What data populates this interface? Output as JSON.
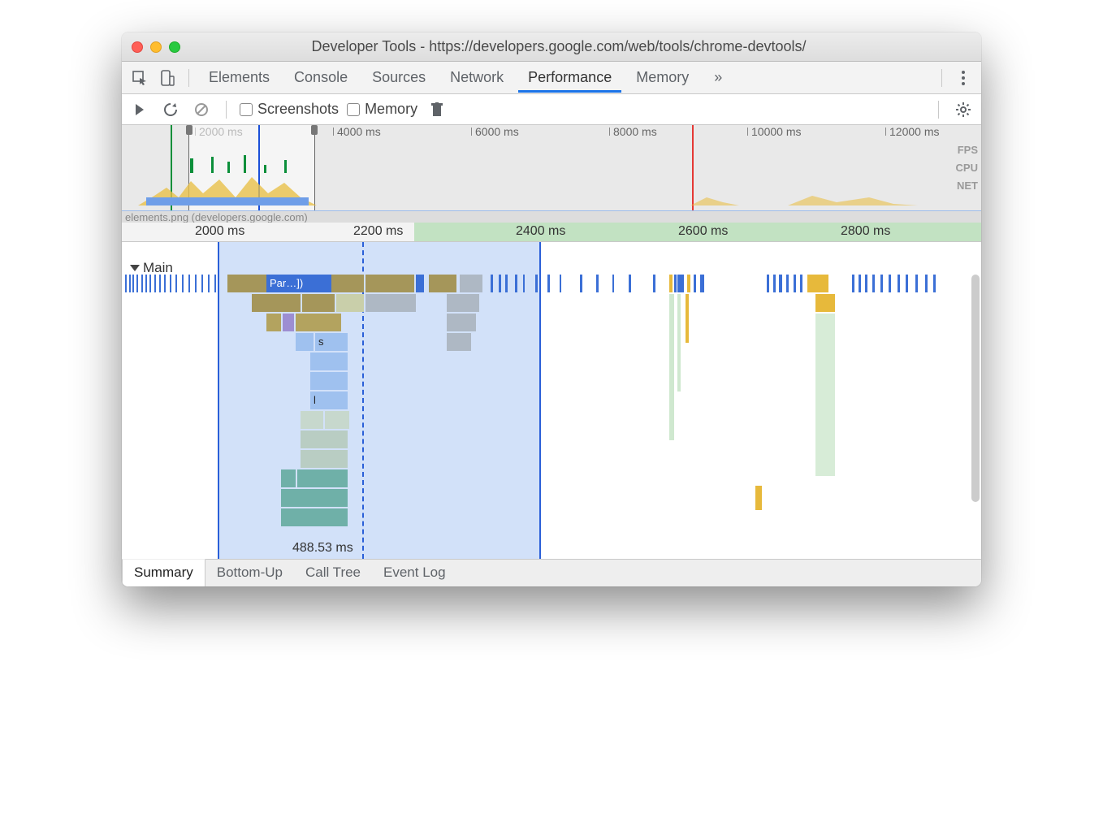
{
  "window": {
    "title": "Developer Tools - https://developers.google.com/web/tools/chrome-devtools/"
  },
  "panelTabs": {
    "elements": "Elements",
    "console": "Console",
    "sources": "Sources",
    "network": "Network",
    "performance": "Performance",
    "memory": "Memory"
  },
  "toolbar": {
    "screenshots": "Screenshots",
    "memory": "Memory"
  },
  "overview": {
    "ticks": [
      "2000 ms",
      "4000 ms",
      "6000 ms",
      "8000 ms",
      "10000 ms",
      "12000 ms"
    ],
    "rows": {
      "fps": "FPS",
      "cpu": "CPU",
      "net": "NET"
    }
  },
  "ruler": {
    "caption": "elements.png (developers.google.com)",
    "ticks": [
      "2000 ms",
      "2200 ms",
      "2400 ms",
      "2600 ms",
      "2800 ms"
    ]
  },
  "main": {
    "label": "Main",
    "firstBlock": "Par…])",
    "sLabel": "s",
    "lLabel": "l",
    "selection": "488.53 ms"
  },
  "detailTabs": {
    "summary": "Summary",
    "bottomup": "Bottom-Up",
    "calltree": "Call Tree",
    "eventlog": "Event Log"
  }
}
